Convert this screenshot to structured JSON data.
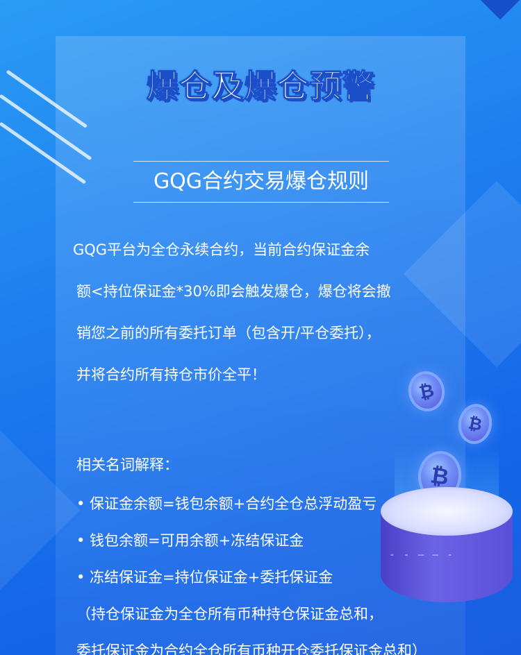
{
  "title": "爆仓及爆仓预警",
  "subtitle": "GQG合约交易爆仓规则",
  "intro_lines": [
    "GQG平台为全仓永续合约，当前合约保证金余",
    "额<持位保证金*30%即会触发爆仓，爆仓将会撤",
    "销您之前的所有委托订单（包含开/平仓委托），",
    "并将合约所有持仓市价全平！"
  ],
  "glossary_heading": "相关名词解释：",
  "glossary_items": [
    "• 保证金余额=钱包余额+合约全仓总浮动盈亏",
    "• 钱包余额=可用余额+冻结保证金",
    "• 冻结保证金=持位保证金+委托保证金"
  ],
  "note_lines": [
    "（持仓保证金为全仓所有币种持仓保证金总和，",
    "委托保证金为合约全仓所有币种开仓委托保证金总和）"
  ],
  "decor": {
    "coin_glyph": "₿",
    "podium_lights": "- - —  — -"
  },
  "colors": {
    "background_top": "#2b9bf4",
    "background_bottom": "#1566e8",
    "title_shadow": "#1a4fc9",
    "text": "#ffffff"
  }
}
